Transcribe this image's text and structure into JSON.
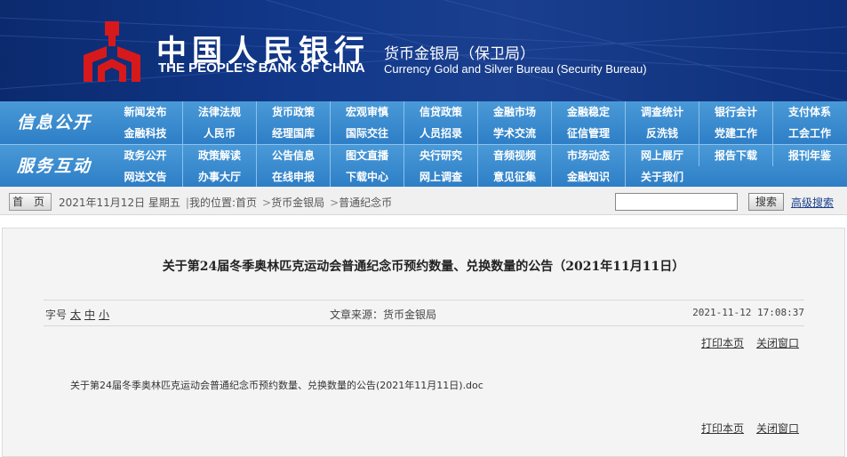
{
  "header": {
    "cn_title": "中国人民银行",
    "en_title": "THE PEOPLE'S BANK OF CHINA",
    "bureau_cn": "货币金银局（保卫局）",
    "bureau_en": "Currency  Gold and Silver Bureau (Security Bureau)"
  },
  "nav": {
    "section1_label": "信息公开",
    "section2_label": "服务互动",
    "row1": [
      "新闻发布",
      "法律法规",
      "货币政策",
      "宏观审慎",
      "信贷政策",
      "金融市场",
      "金融稳定",
      "调查统计",
      "银行会计",
      "支付体系"
    ],
    "row2": [
      "金融科技",
      "人民币",
      "经理国库",
      "国际交往",
      "人员招录",
      "学术交流",
      "征信管理",
      "反洗钱",
      "党建工作",
      "工会工作"
    ],
    "row3": [
      "政务公开",
      "政策解读",
      "公告信息",
      "图文直播",
      "央行研究",
      "音频视频",
      "市场动态",
      "网上展厅",
      "报告下载",
      "报刊年鉴"
    ],
    "row4": [
      "网送文告",
      "办事大厅",
      "在线申报",
      "下载中心",
      "网上调查",
      "意见征集",
      "金融知识",
      "关于我们"
    ]
  },
  "crumbs": {
    "home": "首 页",
    "date": "2021年11月12日 星期五",
    "location_label": "我的位置:",
    "items": [
      "首页",
      "货币金银局",
      "普通纪念币"
    ],
    "search_button": "搜索",
    "advanced_search": "高级搜索"
  },
  "article": {
    "title": "关于第24届冬季奥林匹克运动会普通纪念币预约数量、兑换数量的公告（2021年11月11日）",
    "fontsize_label": "字号",
    "fontsize_options": [
      "太",
      "中",
      "小"
    ],
    "source": "文章来源：货币金银局",
    "published": "2021-11-12  17:08:37",
    "print": "打印本页",
    "close": "关闭窗口",
    "attachment": "关于第24届冬季奥林匹克运动会普通纪念币预约数量、兑换数量的公告(2021年11月11日).doc"
  },
  "colors": {
    "banner": "#12388a",
    "nav": "#2d7ec6",
    "emblem": "#d7191c"
  }
}
